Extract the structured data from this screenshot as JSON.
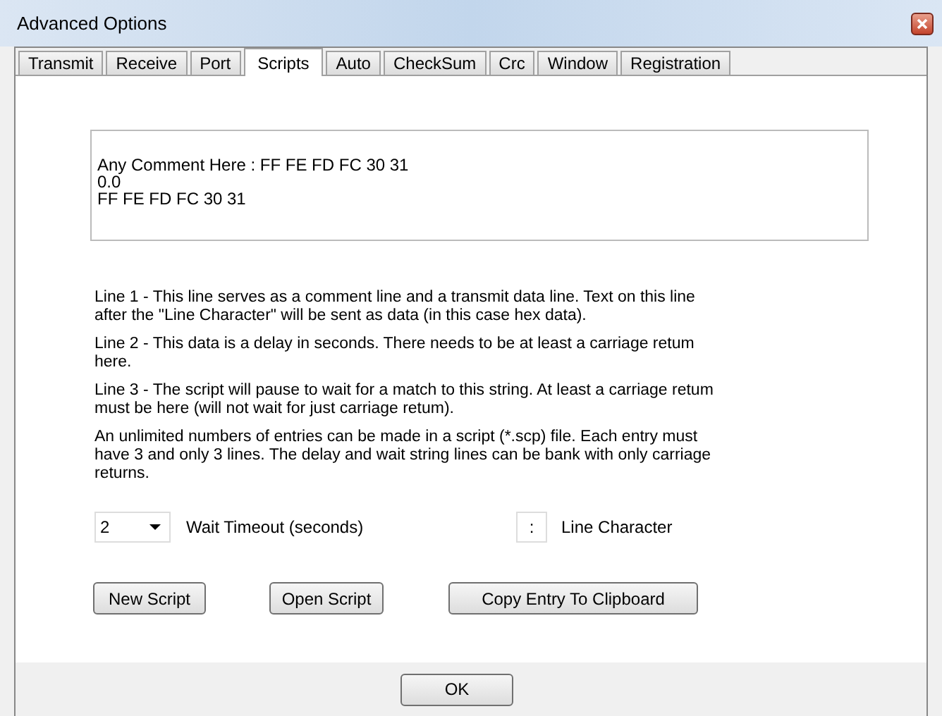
{
  "window": {
    "title": "Advanced Options"
  },
  "tabs": [
    {
      "label": "Transmit",
      "selected": false
    },
    {
      "label": "Receive",
      "selected": false
    },
    {
      "label": "Port",
      "selected": false
    },
    {
      "label": "Scripts",
      "selected": true
    },
    {
      "label": "Auto",
      "selected": false
    },
    {
      "label": "CheckSum",
      "selected": false
    },
    {
      "label": "Crc",
      "selected": false
    },
    {
      "label": "Window",
      "selected": false
    },
    {
      "label": "Registration",
      "selected": false
    }
  ],
  "script_box": {
    "lines": [
      "Any Comment Here : FF FE FD FC 30 31",
      "0.0",
      "FF FE FD FC 30 31"
    ]
  },
  "help": [
    "Line 1 - This line serves as a comment line and a transmit data line. Text on this line after the \"Line Character\" will be sent as data (in this case hex data).",
    "Line 2 - This data is a delay in seconds. There needs to be at least a carriage retum here.",
    "Line 3 - The script will pause to wait for a match to this string. At least a carriage retum must be here (will not wait for just carriage retum).",
    "An unlimited numbers of entries can be made in a script (*.scp) file. Each entry must have 3 and only 3 lines. The delay and wait string lines can be bank with only carriage returns."
  ],
  "wait_timeout": {
    "value": "2",
    "label": "Wait Timeout (seconds)"
  },
  "line_character": {
    "value": ":",
    "label": "Line Character"
  },
  "buttons": [
    "New Script",
    "Open Script",
    "Copy Entry To Clipboard"
  ],
  "footer": {
    "button": "OK"
  }
}
